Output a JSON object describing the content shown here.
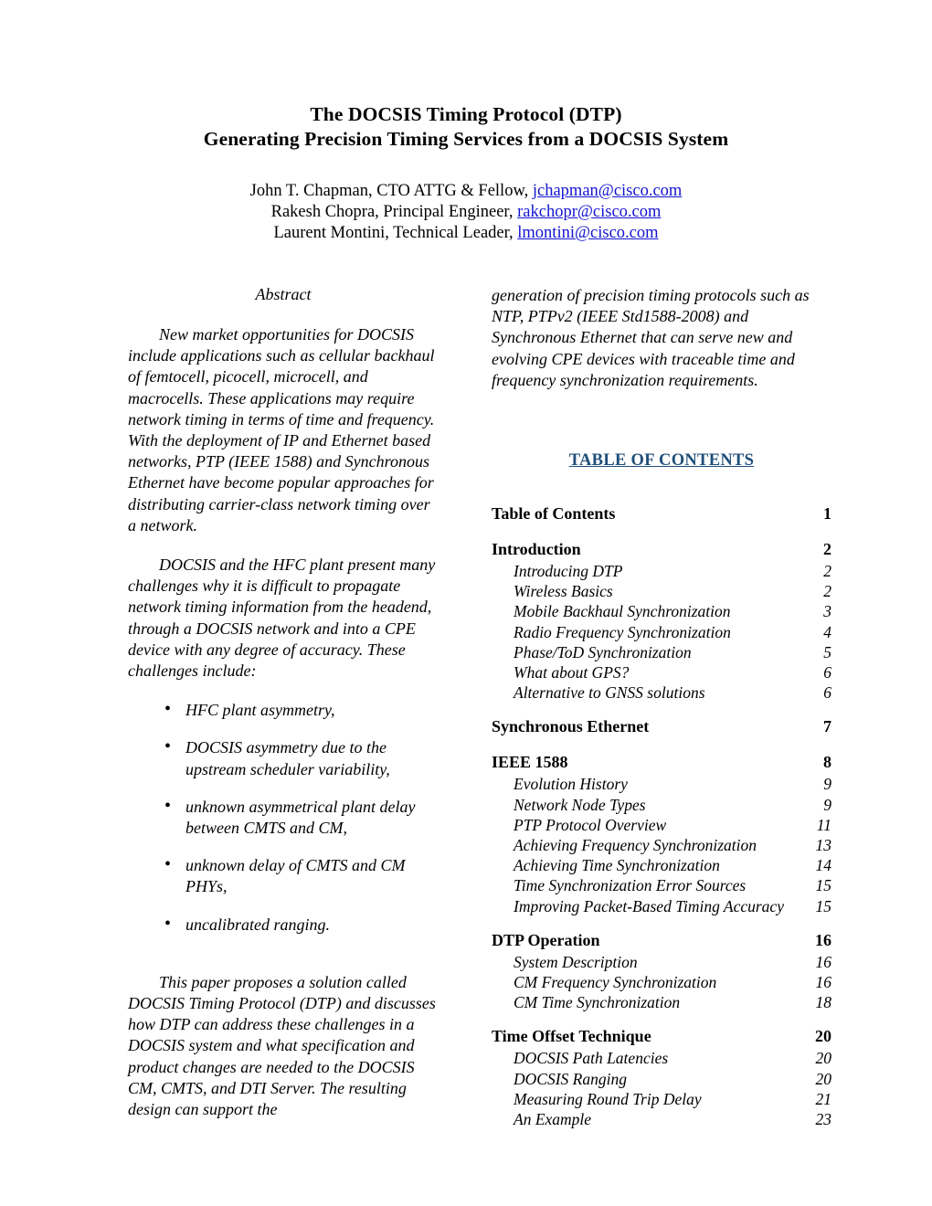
{
  "title": {
    "line1": "The DOCSIS Timing Protocol (DTP)",
    "line2": "Generating Precision Timing Services from a DOCSIS System"
  },
  "authors": [
    {
      "name_role": "John T. Chapman, CTO ATTG & Fellow, ",
      "email": "jchapman@cisco.com"
    },
    {
      "name_role": "Rakesh Chopra, Principal Engineer, ",
      "email": "rakchopr@cisco.com"
    },
    {
      "name_role": "Laurent Montini, Technical Leader, ",
      "email": "lmontini@cisco.com"
    }
  ],
  "colors": {
    "link": "#1414d2",
    "heading_accent": "#1f4e79",
    "text": "#000000"
  },
  "abstract": {
    "heading": "Abstract",
    "para1": "New market opportunities for DOCSIS include applications such as cellular backhaul of femtocell, picocell, microcell, and macrocells. These applications may require network timing in terms of time and frequency. With the deployment of IP and Ethernet based networks, PTP (IEEE 1588) and Synchronous Ethernet have become popular approaches for distributing carrier-class network timing over a network.",
    "para2": "DOCSIS and the HFC plant present many challenges why it is difficult to propagate network timing information from the headend, through a DOCSIS network and into a CPE device with any degree of accuracy. These challenges include:",
    "bullets": [
      "HFC plant asymmetry,",
      "DOCSIS asymmetry due to the upstream scheduler variability,",
      "unknown asymmetrical plant delay between CMTS and CM,",
      "unknown delay of CMTS and CM PHYs,",
      "uncalibrated ranging."
    ],
    "bullet_marker": "•",
    "para3": "This paper proposes a solution called DOCSIS Timing Protocol (DTP) and discusses how DTP can address these challenges in a DOCSIS system and what specification and product changes are needed to the DOCSIS CM, CMTS, and DTI Server. The resulting design can support the",
    "para3_continued": "generation of precision timing protocols such as NTP, PTPv2 (IEEE Std1588-2008) and Synchronous Ethernet that can serve new and evolving CPE devices with traceable time and frequency synchronization requirements."
  },
  "toc": {
    "heading": "TABLE OF CONTENTS",
    "entries": [
      {
        "level": 1,
        "label": "Table of Contents",
        "page": "1"
      },
      {
        "level": 1,
        "label": "Introduction",
        "page": "2"
      },
      {
        "level": 2,
        "label": "Introducing DTP",
        "page": "2"
      },
      {
        "level": 2,
        "label": "Wireless Basics",
        "page": "2"
      },
      {
        "level": 2,
        "label": "Mobile Backhaul Synchronization",
        "page": "3"
      },
      {
        "level": 2,
        "label": "Radio Frequency Synchronization",
        "page": "4"
      },
      {
        "level": 2,
        "label": "Phase/ToD Synchronization",
        "page": "5"
      },
      {
        "level": 2,
        "label": "What about GPS?",
        "page": "6"
      },
      {
        "level": 2,
        "label": "Alternative to GNSS solutions",
        "page": "6"
      },
      {
        "level": 1,
        "label": "Synchronous Ethernet",
        "page": "7"
      },
      {
        "level": 1,
        "label": "IEEE 1588",
        "page": "8"
      },
      {
        "level": 2,
        "label": "Evolution History",
        "page": "9"
      },
      {
        "level": 2,
        "label": "Network Node Types",
        "page": "9"
      },
      {
        "level": 2,
        "label": "PTP Protocol Overview",
        "page": "11"
      },
      {
        "level": 2,
        "label": "Achieving Frequency Synchronization",
        "page": "13"
      },
      {
        "level": 2,
        "label": "Achieving Time Synchronization",
        "page": "14"
      },
      {
        "level": 2,
        "label": "Time Synchronization Error Sources",
        "page": "15"
      },
      {
        "level": 2,
        "label": "Improving Packet-Based Timing Accuracy",
        "page": "15"
      },
      {
        "level": 1,
        "label": "DTP Operation",
        "page": "16"
      },
      {
        "level": 2,
        "label": "System Description",
        "page": "16"
      },
      {
        "level": 2,
        "label": "CM Frequency Synchronization",
        "page": "16"
      },
      {
        "level": 2,
        "label": "CM Time Synchronization",
        "page": "18"
      },
      {
        "level": 1,
        "label": "Time Offset Technique",
        "page": "20"
      },
      {
        "level": 2,
        "label": "DOCSIS Path Latencies",
        "page": "20"
      },
      {
        "level": 2,
        "label": "DOCSIS Ranging",
        "page": "20"
      },
      {
        "level": 2,
        "label": "Measuring Round Trip Delay",
        "page": "21"
      },
      {
        "level": 2,
        "label": "An Example",
        "page": "23"
      }
    ]
  }
}
